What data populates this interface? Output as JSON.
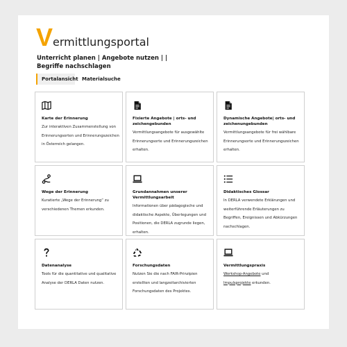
{
  "header": {
    "brand_initial": "V",
    "brand_rest": "ermittlungsportal",
    "subtitle": "Unterricht planen | Angebote nutzen | | Begriffe nachschlagen"
  },
  "tabs": [
    {
      "label": "Portalansicht",
      "active": true
    },
    {
      "label": "Materialsuche",
      "active": false
    }
  ],
  "colors": {
    "accent": "#f4a300",
    "border": "#cfcfcf",
    "page_bg": "#ececec"
  },
  "cards": [
    {
      "icon": "map-icon",
      "title": "Karte der Erinnerung",
      "desc": "Zur interaktiven Zusammenstellung von Erinnerungsorten und Erinnerungszeichen in Österreich gelangen."
    },
    {
      "icon": "document-icon",
      "title": "Fixierte Angebote | orts- und zeichengebunden",
      "desc": "Vermittlungsangebote für ausgewählte Erinnerungsorte und Erinnerungszeichen erhalten."
    },
    {
      "icon": "document-icon",
      "title": "Dynamische Angebote| orts- und zeichenungebunden",
      "desc": "Vermittlungsangebote für frei wählbare Erinnerungsorte und Erinnerungszeichen erhalten."
    },
    {
      "icon": "route-icon",
      "title": "Wege der Erinnerung",
      "desc": "Kuratierte „Wege der Erinnerung“ zu verschiedenen Themen erkunden."
    },
    {
      "icon": "laptop-icon",
      "title": "Grundannahmen unserer Vermittlungsarbeit",
      "desc": "Informationen über pädagogische und didaktische Aspekte, Überlegungen und Positionen, die DERLA zugrunde liegen, erhalten."
    },
    {
      "icon": "list-icon",
      "title": "Didaktisches Glossar",
      "desc": "In DERLA verwendete Erklärungen und weiterführende Erläuterungen zu Begriffen, Ereignissen und Abkürzungen nachschlagen."
    },
    {
      "icon": "question-icon",
      "title": "Datenanalyse",
      "desc": "Tools für die quantitative und qualitative Analyse der DERLA Daten nutzen."
    },
    {
      "icon": "recycle-icon",
      "title": "Forschungsdaten",
      "desc": "Nutzen Sie die nach FAIR-Prinzipien erstellten und langzeitarchivierten Forschungsdaten des Projektes."
    },
    {
      "icon": "laptop-icon",
      "title": "Vermittlungspraxis",
      "desc_link1": "Workshop-Angebote",
      "desc_mid": " und ",
      "desc_link2": "Impulsprojekte",
      "desc_end": " erkunden."
    }
  ]
}
